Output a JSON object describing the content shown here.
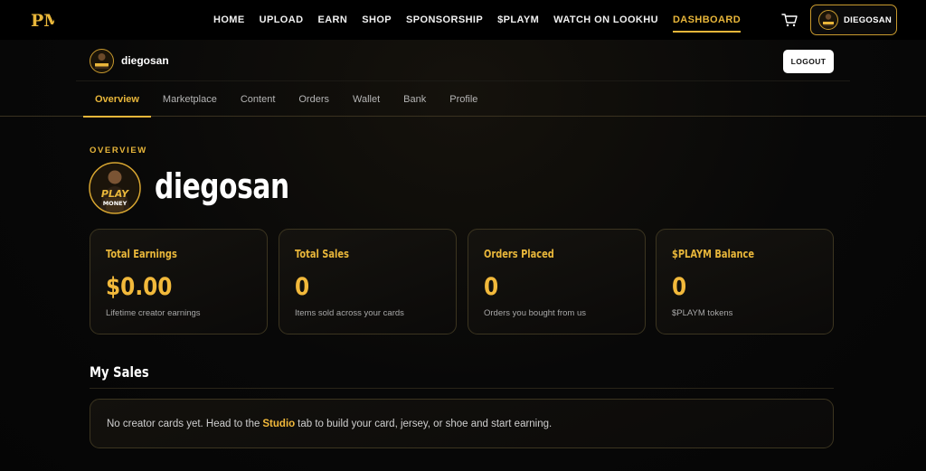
{
  "nav": {
    "logo_text": "PM",
    "links": [
      "HOME",
      "UPLOAD",
      "EARN",
      "SHOP",
      "SPONSORSHIP",
      "$PLAYM",
      "WATCH ON LOOKHU",
      "DASHBOARD"
    ],
    "active": "DASHBOARD",
    "user_name": "DIEGOSAN",
    "cart_icon": "cart-icon"
  },
  "subheader": {
    "username": "diegosan",
    "logout_label": "LOGOUT"
  },
  "tabs": [
    "Overview",
    "Marketplace",
    "Content",
    "Orders",
    "Wallet",
    "Bank",
    "Profile"
  ],
  "active_tab": "Overview",
  "overview": {
    "eyebrow": "OVERVIEW",
    "name": "diegosan",
    "avatar_text_top": "PLAY",
    "avatar_text_bottom": "MONEY"
  },
  "stats": [
    {
      "title": "Total Earnings",
      "value": "$0.00",
      "sub": "Lifetime creator earnings"
    },
    {
      "title": "Total Sales",
      "value": "0",
      "sub": "Items sold across your cards"
    },
    {
      "title": "Orders Placed",
      "value": "0",
      "sub": "Orders you bought from us"
    },
    {
      "title": "$PLAYM Balance",
      "value": "0",
      "sub": "$PLAYM tokens"
    }
  ],
  "sales": {
    "title": "My Sales",
    "empty_before": "No creator cards yet. Head to the ",
    "empty_link": "Studio",
    "empty_after": " tab to build your card, jersey, or shoe and start earning."
  },
  "colors": {
    "accent": "#e8b63a",
    "background": "#080808",
    "card_border": "#3c3520"
  }
}
